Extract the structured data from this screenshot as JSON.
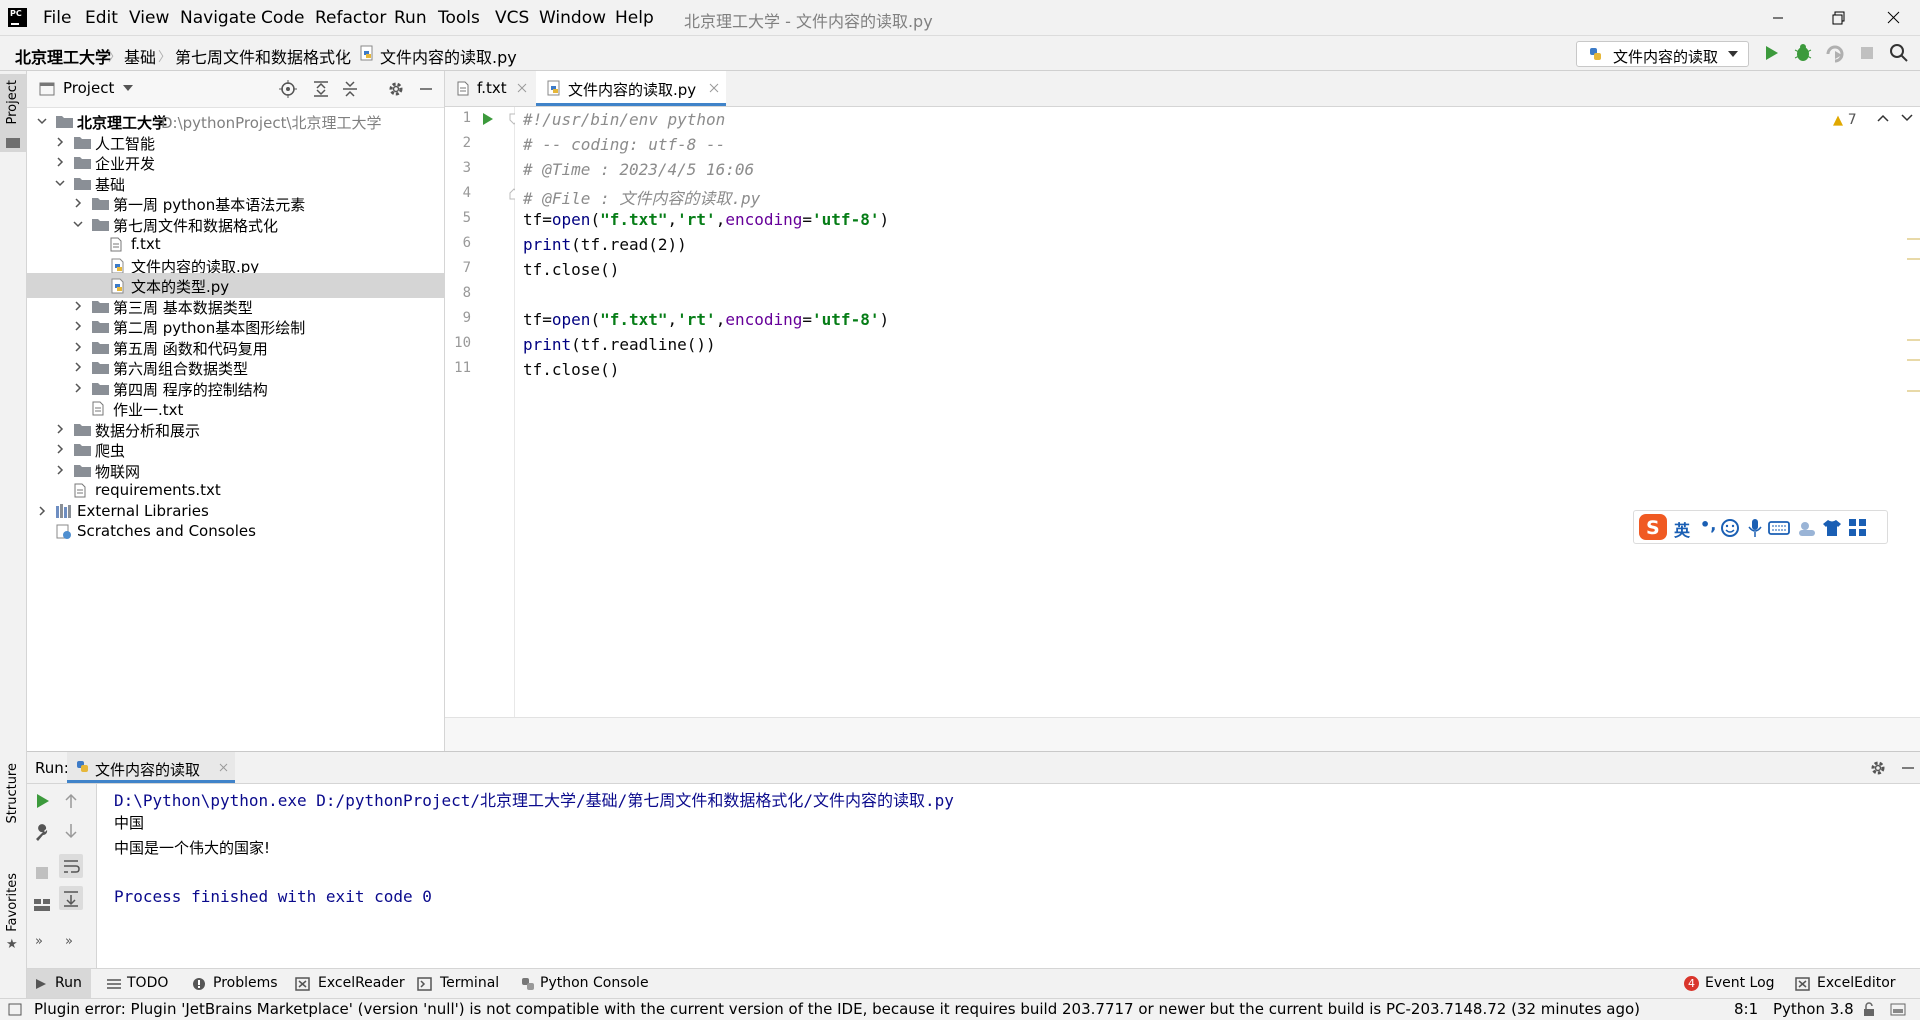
{
  "app": {
    "logo_text": "PC",
    "window_title": "北京理工大学 - 文件内容的读取.py",
    "menu": [
      "File",
      "Edit",
      "View",
      "Navigate",
      "Code",
      "Refactor",
      "Run",
      "Tools",
      "VCS",
      "Window",
      "Help"
    ]
  },
  "breadcrumbs": [
    "北京理工大学",
    "基础",
    "第七周文件和数据格式化",
    "文件内容的读取.py"
  ],
  "run_config": {
    "label": "文件内容的读取"
  },
  "left_strip": {
    "project_tab": "Project",
    "structure_tab": "Structure",
    "favorites_tab": "Favorites"
  },
  "project_panel": {
    "title": "Project",
    "tree": [
      {
        "label": "北京理工大学",
        "path": "D:\\pythonProject\\北京理工大学",
        "type": "folder",
        "depth": 0,
        "expanded": true
      },
      {
        "label": "人工智能",
        "type": "folder",
        "depth": 1,
        "expanded": false
      },
      {
        "label": "企业开发",
        "type": "folder",
        "depth": 1,
        "expanded": false
      },
      {
        "label": "基础",
        "type": "folder",
        "depth": 1,
        "expanded": true
      },
      {
        "label": "第一周 python基本语法元素",
        "type": "folder",
        "depth": 2,
        "expanded": false
      },
      {
        "label": "第七周文件和数据格式化",
        "type": "folder",
        "depth": 2,
        "expanded": true
      },
      {
        "label": "f.txt",
        "type": "file",
        "depth": 3
      },
      {
        "label": "文件内容的读取.py",
        "type": "py",
        "depth": 3
      },
      {
        "label": "文本的类型.py",
        "type": "py",
        "depth": 3,
        "selected": true
      },
      {
        "label": "第三周 基本数据类型",
        "type": "folder",
        "depth": 2,
        "expanded": false
      },
      {
        "label": "第二周 python基本图形绘制",
        "type": "folder",
        "depth": 2,
        "expanded": false
      },
      {
        "label": "第五周 函数和代码复用",
        "type": "folder",
        "depth": 2,
        "expanded": false
      },
      {
        "label": "第六周组合数据类型",
        "type": "folder",
        "depth": 2,
        "expanded": false
      },
      {
        "label": "第四周 程序的控制结构",
        "type": "folder",
        "depth": 2,
        "expanded": false
      },
      {
        "label": "作业一.txt",
        "type": "file",
        "depth": 2
      },
      {
        "label": "数据分析和展示",
        "type": "folder",
        "depth": 1,
        "expanded": false
      },
      {
        "label": "爬虫",
        "type": "folder",
        "depth": 1,
        "expanded": false
      },
      {
        "label": "物联网",
        "type": "folder",
        "depth": 1,
        "expanded": false
      },
      {
        "label": "requirements.txt",
        "type": "file",
        "depth": 1
      },
      {
        "label": "External Libraries",
        "type": "lib",
        "depth": 0,
        "expanded": false
      },
      {
        "label": "Scratches and Consoles",
        "type": "scratch",
        "depth": 0
      }
    ]
  },
  "editor": {
    "tabs": [
      {
        "label": "f.txt",
        "active": false
      },
      {
        "label": "文件内容的读取.py",
        "active": true
      }
    ],
    "warnings_count": "7",
    "lines": [
      {
        "n": "1",
        "text": "#!/usr/bin/env python"
      },
      {
        "n": "2",
        "text": "# -- coding: utf-8 --"
      },
      {
        "n": "3",
        "text": "# @Time : 2023/4/5 16:06"
      },
      {
        "n": "4",
        "text": "# @File : 文件内容的读取.py"
      },
      {
        "n": "5",
        "text": "tf=open(\"f.txt\",'rt',encoding='utf-8')"
      },
      {
        "n": "6",
        "text": "print(tf.read(2))"
      },
      {
        "n": "7",
        "text": "tf.close()"
      },
      {
        "n": "8",
        "text": ""
      },
      {
        "n": "9",
        "text": "tf=open(\"f.txt\",'rt',encoding='utf-8')"
      },
      {
        "n": "10",
        "text": "print(tf.readline())"
      },
      {
        "n": "11",
        "text": "tf.close()"
      }
    ]
  },
  "ime": {
    "mode": "英"
  },
  "run_panel": {
    "label": "Run:",
    "tab": "文件内容的读取",
    "output": [
      {
        "text": "D:\\Python\\python.exe D:/pythonProject/北京理工大学/基础/第七周文件和数据格式化/文件内容的读取.py",
        "kind": "cmd"
      },
      {
        "text": "中国",
        "kind": "out"
      },
      {
        "text": "中国是一个伟大的国家!",
        "kind": "out"
      },
      {
        "text": "",
        "kind": "out"
      },
      {
        "text": "Process finished with exit code 0",
        "kind": "cmd"
      }
    ]
  },
  "bottom_tabs": {
    "run": "Run",
    "todo": "TODO",
    "problems": "Problems",
    "excelreader": "ExcelReader",
    "terminal": "Terminal",
    "pyconsole": "Python Console",
    "eventlog_count": "4",
    "eventlog": "Event Log",
    "exceleditor": "ExcelEditor"
  },
  "status": {
    "message": "Plugin error: Plugin 'JetBrains Marketplace' (version 'null') is not compatible with the current version of the IDE, because it requires build 203.7717 or newer but the current build is PC-203.7148.72 (32 minutes ago)",
    "position": "8:1",
    "interpreter": "Python 3.8"
  },
  "colors": {
    "accent": "#4083c9",
    "run_green": "#3c9a3c",
    "selection": "#d5d5d5",
    "console_blue": "#0a0a8c"
  }
}
